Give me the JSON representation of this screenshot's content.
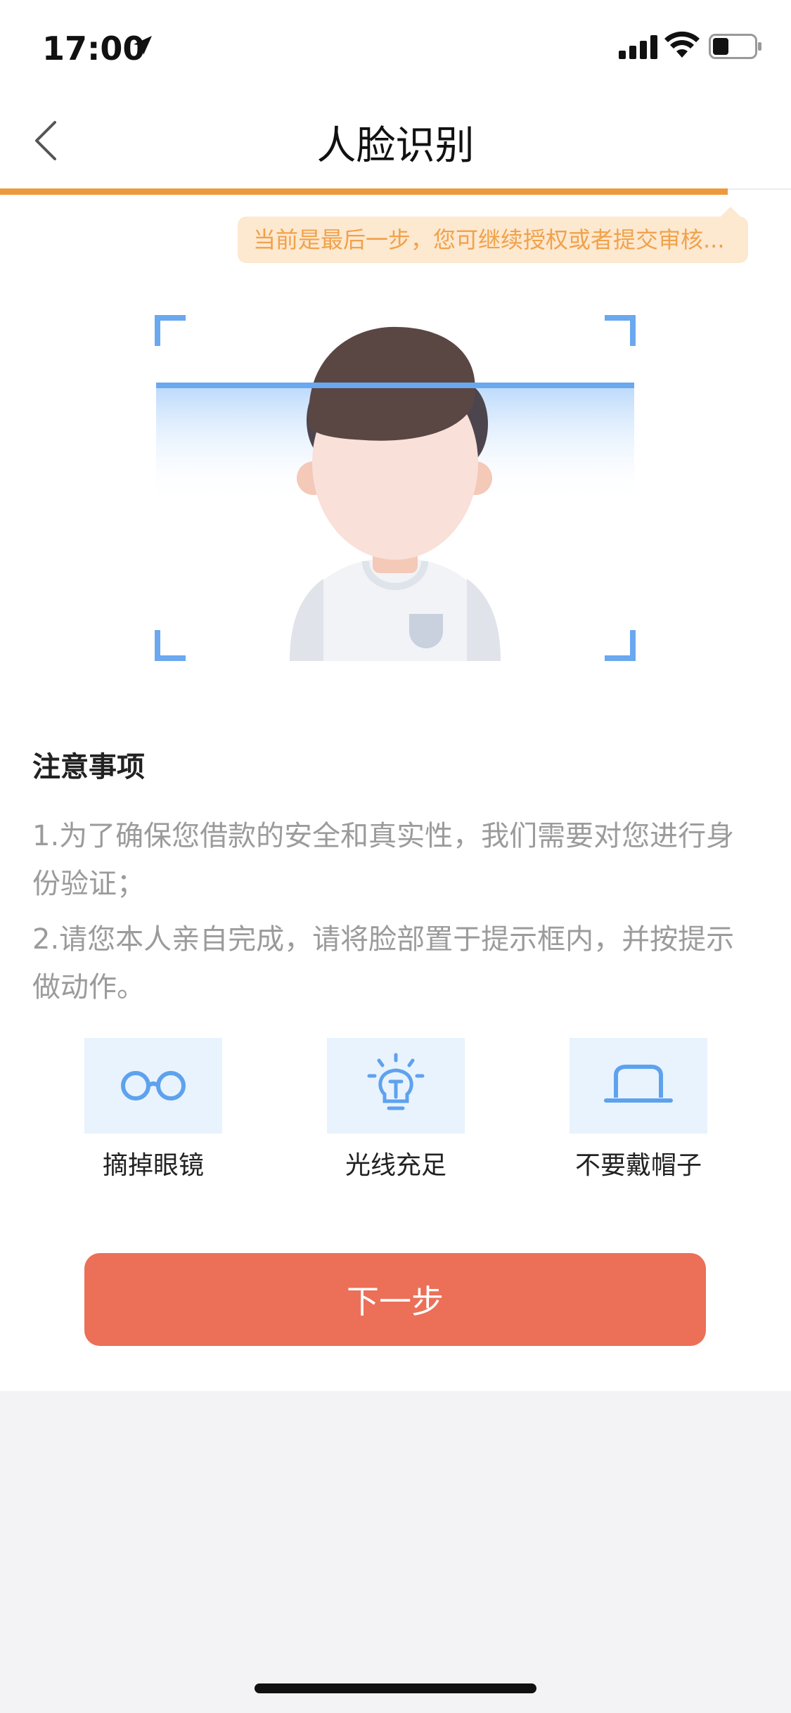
{
  "status_bar": {
    "time": "17:00",
    "icons": [
      "location-arrow-icon",
      "signal-icon",
      "wifi-icon",
      "battery-icon"
    ]
  },
  "nav": {
    "title": "人脸识别",
    "back_icon": "chevron-left-icon"
  },
  "progress": {
    "fraction": 0.92,
    "color": "#ee9a3c"
  },
  "tip_banner": {
    "text": "当前是最后一步，您可继续授权或者提交审核..."
  },
  "notes": {
    "title": "注意事项",
    "items": [
      "1.为了确保您借款的安全和真实性，我们需要对您进行身份验证；",
      "2.请您本人亲自完成，请将脸部置于提示框内，并按提示做动作。"
    ]
  },
  "tips": [
    {
      "icon": "glasses-icon",
      "label": "摘掉眼镜"
    },
    {
      "icon": "light-bulb-icon",
      "label": "光线充足"
    },
    {
      "icon": "hat-icon",
      "label": "不要戴帽子"
    }
  ],
  "next_button": {
    "label": "下一步",
    "color": "#ec6f58"
  },
  "colors": {
    "accent_orange": "#ee9a3c",
    "frame_blue": "#6aa8ef",
    "button_red": "#ec6f58"
  }
}
